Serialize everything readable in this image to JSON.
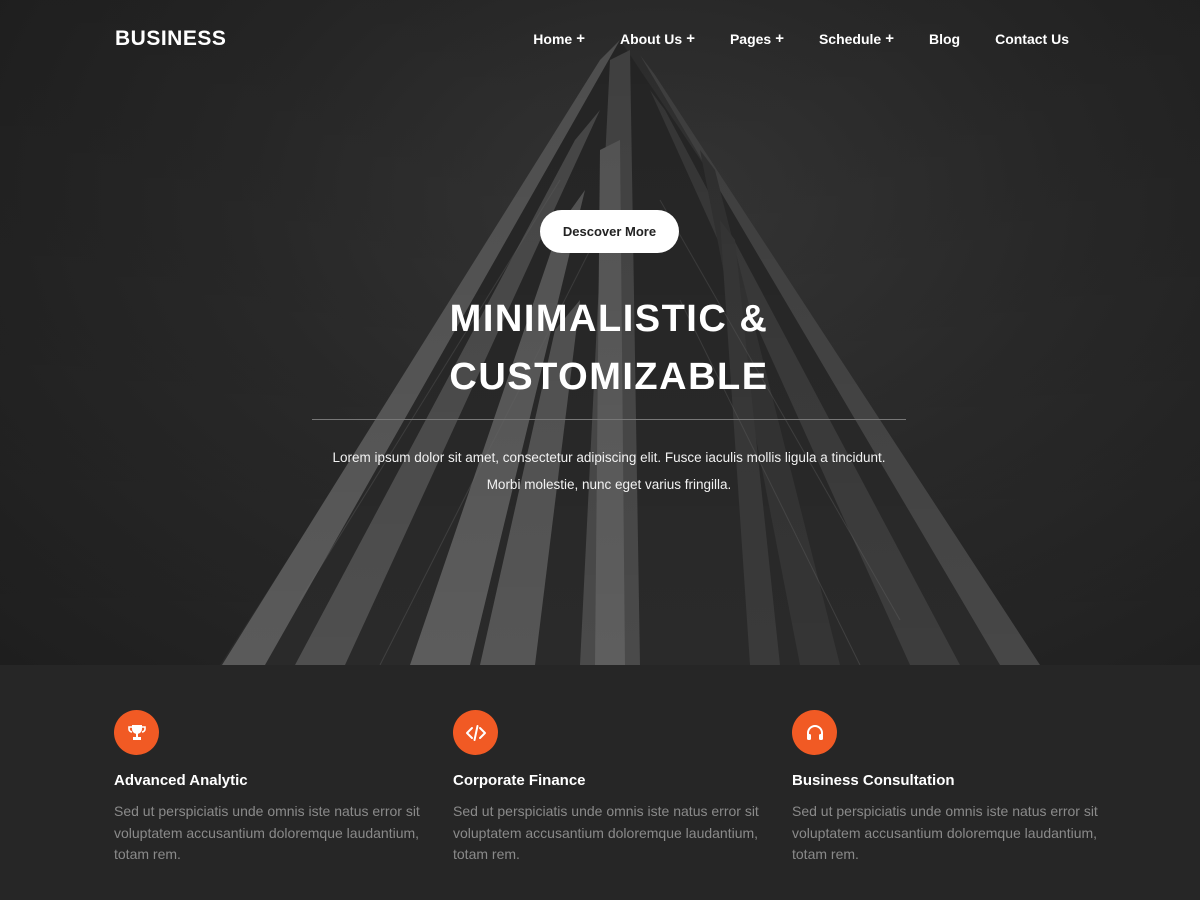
{
  "header": {
    "logo": "BUSINESS",
    "menu": [
      {
        "label": "Home",
        "has_submenu": true
      },
      {
        "label": "About Us",
        "has_submenu": true
      },
      {
        "label": "Pages",
        "has_submenu": true
      },
      {
        "label": "Schedule",
        "has_submenu": true
      },
      {
        "label": "Blog",
        "has_submenu": false
      },
      {
        "label": "Contact Us",
        "has_submenu": false
      }
    ],
    "submenu_glyph": "+"
  },
  "hero": {
    "button_label": "Descover More",
    "title_line1": "MINIMALISTIC &",
    "title_line2": "CUSTOMIZABLE",
    "description": "Lorem ipsum dolor sit amet, consectetur adipiscing elit. Fusce iaculis mollis ligula a tincidunt. Morbi molestie, nunc eget varius fringilla."
  },
  "features": [
    {
      "icon": "trophy-icon",
      "title": "Advanced Analytic",
      "text": "Sed ut perspiciatis unde omnis iste natus error sit voluptatem accusantium doloremque laudantium, totam rem."
    },
    {
      "icon": "code-icon",
      "title": "Corporate Finance",
      "text": "Sed ut perspiciatis unde omnis iste natus error sit voluptatem accusantium doloremque laudantium, totam rem."
    },
    {
      "icon": "headphones-icon",
      "title": "Business Consultation",
      "text": "Sed ut perspiciatis unde omnis iste natus error sit voluptatem accusantium doloremque laudantium, totam rem."
    }
  ],
  "colors": {
    "accent": "#f15a24",
    "background": "#262626",
    "muted_text": "#8a8a8a"
  }
}
